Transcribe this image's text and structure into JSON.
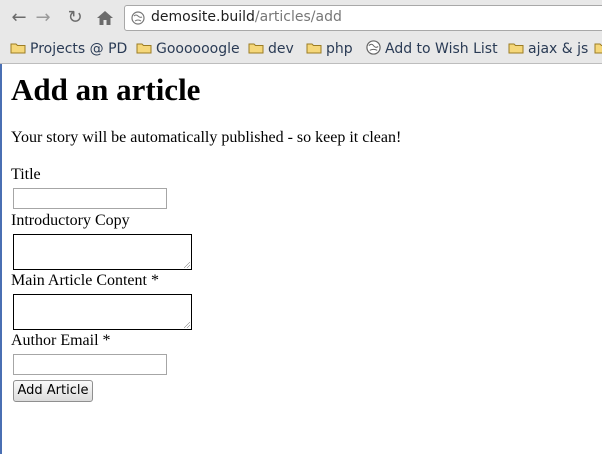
{
  "browser": {
    "url_host": "demosite.build",
    "url_path": "/articles/add",
    "bookmarks": [
      {
        "label": "Projects @ PD",
        "icon": "folder-icon"
      },
      {
        "label": "Goooooogle",
        "icon": "folder-icon"
      },
      {
        "label": "dev",
        "icon": "folder-icon"
      },
      {
        "label": "php",
        "icon": "folder-icon"
      },
      {
        "label": "Add to Wish List",
        "icon": "globe-icon"
      },
      {
        "label": "ajax & js",
        "icon": "folder-icon"
      }
    ]
  },
  "page": {
    "heading": "Add an article",
    "intro": "Your story will be automatically published - so keep it clean!",
    "fields": {
      "title": {
        "label": "Title",
        "value": ""
      },
      "intro_copy": {
        "label": "Introductory Copy",
        "value": ""
      },
      "main_content": {
        "label": "Main Article Content *",
        "value": ""
      },
      "author_email": {
        "label": "Author Email *",
        "value": ""
      }
    },
    "submit_label": "Add Article"
  }
}
